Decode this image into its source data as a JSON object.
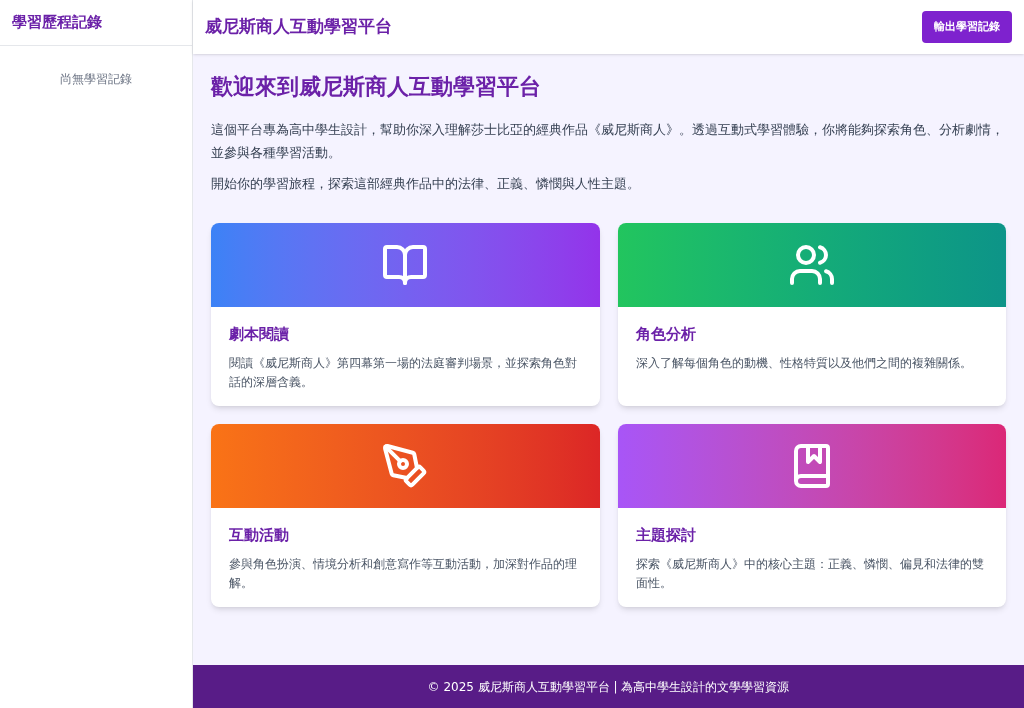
{
  "sidebar": {
    "title": "學習歷程記錄",
    "empty_message": "尚無學習記錄"
  },
  "header": {
    "title": "威尼斯商人互動學習平台",
    "export_button": "輸出學習記錄"
  },
  "welcome": {
    "heading": "歡迎來到威尼斯商人互動學習平台",
    "paragraphs": [
      "這個平台專為高中學生設計，幫助你深入理解莎士比亞的經典作品《威尼斯商人》。透過互動式學習體驗，你將能夠探索角色、分析劇情，並參與各種學習活動。",
      "開始你的學習旅程，探索這部經典作品中的法律、正義、憐憫與人性主題。"
    ]
  },
  "cards": [
    {
      "kind": "reading",
      "title": "劇本閱讀",
      "description": "閱讀《威尼斯商人》第四幕第一場的法庭審判場景，並探索角色對話的深層含義。"
    },
    {
      "kind": "characters",
      "title": "角色分析",
      "description": "深入了解每個角色的動機、性格特質以及他們之間的複雜關係。"
    },
    {
      "kind": "activities",
      "title": "互動活動",
      "description": "參與角色扮演、情境分析和創意寫作等互動活動，加深對作品的理解。"
    },
    {
      "kind": "themes",
      "title": "主題探討",
      "description": "探索《威尼斯商人》中的核心主題：正義、憐憫、偏見和法律的雙面性。"
    }
  ],
  "footer": {
    "text": "© 2025 威尼斯商人互動學習平台 | 為高中學生設計的文學學習資源"
  }
}
